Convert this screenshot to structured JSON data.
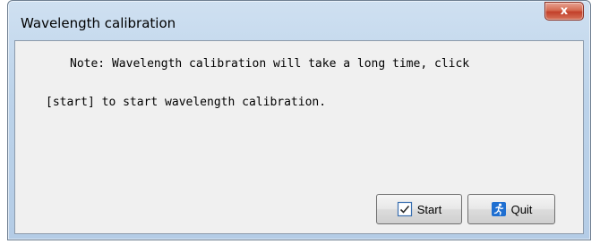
{
  "window": {
    "title": "Wavelength calibration",
    "close_glyph": "x"
  },
  "message": {
    "line1": "Note: Wavelength calibration will take a long time, click",
    "line2": "[start] to start wavelength calibration."
  },
  "buttons": {
    "start": {
      "label": "Start",
      "icon": "checkbox-check-icon"
    },
    "quit": {
      "label": "Quit",
      "icon": "running-man-icon"
    }
  },
  "colors": {
    "frame": "#b9cfe7",
    "client": "#f0f0f0",
    "close": "#c7432e",
    "quit_icon": "#1f6fd1"
  }
}
